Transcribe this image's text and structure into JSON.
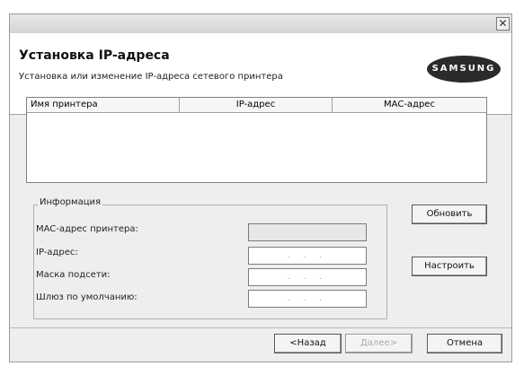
{
  "window": {
    "close_glyph": "✕"
  },
  "header": {
    "title": "Установка IP-адреса",
    "subtitle": "Установка или изменение IP-адреса сетевого принтера",
    "logo": "SAMSUNG"
  },
  "table": {
    "columns": [
      "Имя принтера",
      "IP-адрес",
      "MAC-адрес"
    ],
    "rows": []
  },
  "info": {
    "title": "Информация",
    "fields": [
      {
        "label": "MAC-адрес принтера:",
        "value": ""
      },
      {
        "label": "IP-адрес:",
        "value": ". . ."
      },
      {
        "label": "Маска подсети:",
        "value": ". . ."
      },
      {
        "label": "Шлюз по умолчанию:",
        "value": ". . ."
      }
    ]
  },
  "buttons": {
    "refresh": "Обновить",
    "configure": "Настроить",
    "back": "<Назад",
    "next": "Далее>",
    "cancel": "Отмена"
  }
}
